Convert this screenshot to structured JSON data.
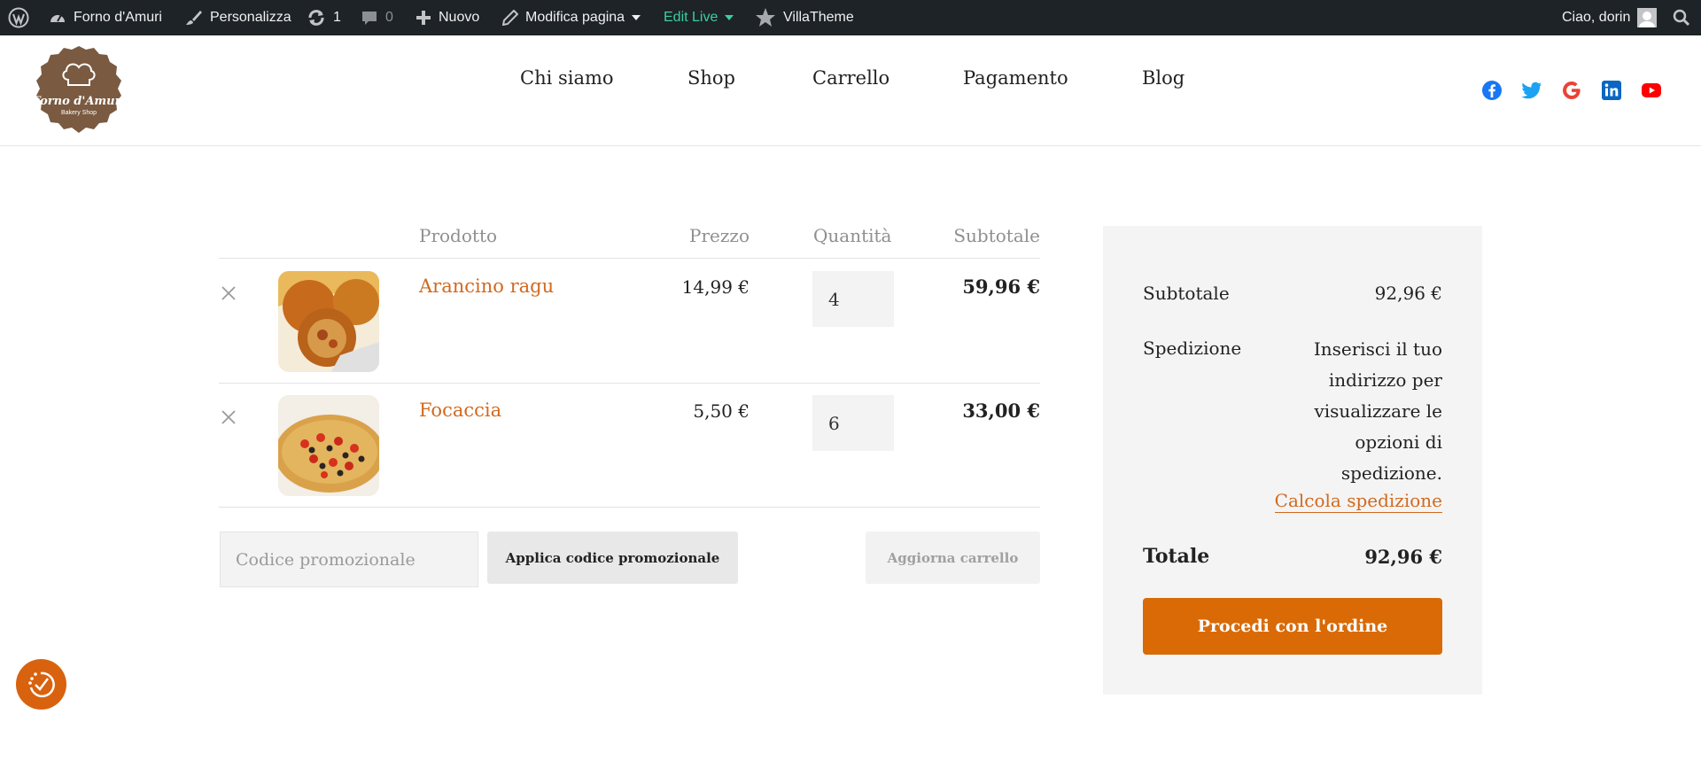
{
  "admin_bar": {
    "site_name": "Forno d'Amuri",
    "customize": "Personalizza",
    "updates_count": "1",
    "comments_count": "0",
    "new": "Nuovo",
    "edit_page": "Modifica pagina",
    "edit_live": "Edit Live",
    "villatheme": "VillaTheme",
    "greeting": "Ciao, dorin"
  },
  "logo": {
    "line1": "Forno d'Amuri",
    "line2": "Bakery Shop"
  },
  "nav": {
    "items": [
      "Chi siamo",
      "Shop",
      "Carrello",
      "Pagamento",
      "Blog"
    ]
  },
  "social": [
    "facebook-icon",
    "twitter-icon",
    "google-icon",
    "linkedin-icon",
    "youtube-icon"
  ],
  "cart": {
    "headers": {
      "product": "Prodotto",
      "price": "Prezzo",
      "quantity": "Quantità",
      "subtotal": "Subtotale"
    },
    "items": [
      {
        "name": "Arancino ragu",
        "price": "14,99 €",
        "quantity": "4",
        "subtotal": "59,96 €"
      },
      {
        "name": "Focaccia",
        "price": "5,50 €",
        "quantity": "6",
        "subtotal": "33,00 €"
      }
    ],
    "coupon_placeholder": "Codice promozionale",
    "apply_coupon": "Applica codice promozionale",
    "update_cart": "Aggiorna carrello"
  },
  "totals": {
    "subtotal_label": "Subtotale",
    "subtotal_value": "92,96 €",
    "shipping_label": "Spedizione",
    "shipping_text": "Inserisci il tuo indirizzo per visualizzare le opzioni di spedizione.",
    "calc_shipping": "Calcola spedizione",
    "total_label": "Totale",
    "total_value": "92,96 €",
    "checkout_button": "Procedi con l'ordine"
  },
  "colors": {
    "accent": "#d96a06",
    "link": "#d2691e",
    "admin_bar": "#1d2327",
    "edit_live": "#3ccfa0"
  }
}
